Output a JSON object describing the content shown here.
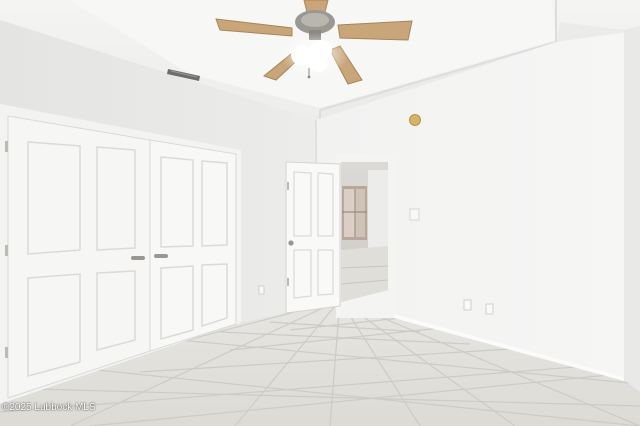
{
  "photo": {
    "watermark": "©2025 Lubbock MLS"
  },
  "colors": {
    "wall_right": "#f1f1f0",
    "wall_left": "#e6e6e5",
    "ceiling": "#f3f3f2",
    "floor_tile": "#e2e1dd",
    "grout": "#cfcdc8",
    "door": "#f7f7f6",
    "fan_blade": "#c9a57a",
    "fan_metal": "#8d8a84",
    "hallway": "#d6d4cf"
  }
}
